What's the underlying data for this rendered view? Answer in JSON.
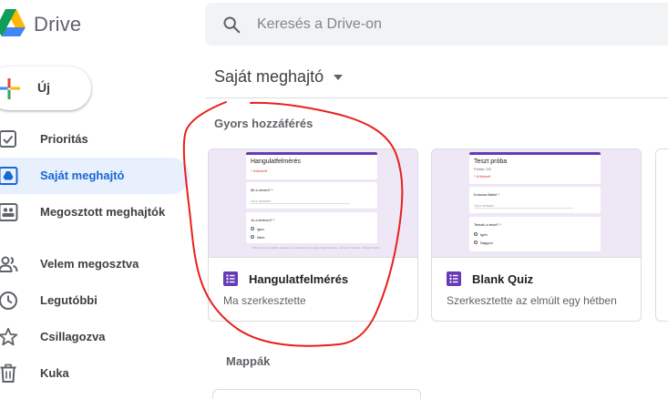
{
  "app": {
    "name": "Drive"
  },
  "search": {
    "placeholder": "Keresés a Drive-on"
  },
  "sidebar": {
    "new_label": "Új",
    "items": [
      {
        "label": "Prioritás",
        "icon": "checkbox-icon",
        "active": false
      },
      {
        "label": "Saját meghajtó",
        "icon": "my-drive-icon",
        "active": true
      },
      {
        "label": "Megosztott meghajtók",
        "icon": "shared-drives-icon",
        "active": false
      },
      {
        "label": "Velem megosztva",
        "icon": "people-icon",
        "active": false
      },
      {
        "label": "Legutóbbi",
        "icon": "clock-icon",
        "active": false
      },
      {
        "label": "Csillagozva",
        "icon": "star-icon",
        "active": false
      },
      {
        "label": "Kuka",
        "icon": "trash-icon",
        "active": false
      }
    ]
  },
  "main": {
    "title": "Saját meghajtó",
    "quick_access": {
      "heading": "Gyors hozzáférés",
      "cards": [
        {
          "title": "Hangulatfelmérés",
          "subtitle": "Ma szerkesztette",
          "icon": "forms-icon",
          "preview": {
            "form_title": "Hangulatfelmérés",
            "required_note": "* Kötelező",
            "question_1": "Mi a neved? *",
            "answer_hint": "Your answer",
            "question_2": "Jó a kedved? *",
            "option_1": "Igen",
            "option_2": "Nem",
            "footer": "This content is neither created nor endorsed by Google. Report Abuse - Terms of Service - Privacy Policy"
          }
        },
        {
          "title": "Blank Quiz",
          "subtitle": "Szerkesztette az elmúlt egy hétben",
          "icon": "forms-icon",
          "preview": {
            "form_title": "Teszt próba",
            "points_note": "Points: 0/0",
            "required_note": "* Kötelező",
            "question_1": "Kolozsa Balint *",
            "answer_hint": "Your answer",
            "question_2": "Tetszik a teszt? *",
            "option_1": "Igen",
            "option_2": "Nagyon"
          }
        }
      ]
    },
    "folders": {
      "heading": "Mappák"
    }
  },
  "colors": {
    "accent_blue": "#1967d2",
    "active_nav_bg": "#e8f0fe",
    "forms_purple": "#673ab7",
    "thumbnail_bg": "#ede7f6",
    "annotation_red": "#e8201c"
  }
}
